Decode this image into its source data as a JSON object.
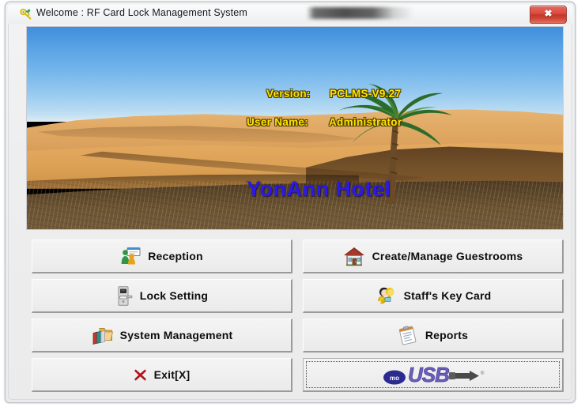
{
  "window": {
    "title": "Welcome : RF Card Lock Management System",
    "title_icon": "key-icon",
    "close_label": "✖",
    "redacted_region": true
  },
  "banner": {
    "version_label": "Version:",
    "version_value": "PCLMS-V9.27",
    "username_label": "User Name:",
    "username_value": "Administrator",
    "hotel_name": "YonAnn Hotel",
    "scene": "desert-dunes-with-palm-tree",
    "text_color_yellow": "#ffe400",
    "text_color_hotel": "#2a1ae8"
  },
  "menu": {
    "buttons": [
      {
        "id": "reception",
        "label": "Reception",
        "icon": "reception-desk-icon",
        "column": "left",
        "row": 1,
        "focused": false
      },
      {
        "id": "guestrooms",
        "label": "Create/Manage Guestrooms",
        "icon": "house-icon",
        "column": "right",
        "row": 1,
        "focused": false
      },
      {
        "id": "lock-setting",
        "label": "Lock Setting",
        "icon": "door-lock-icon",
        "column": "left",
        "row": 2,
        "focused": false
      },
      {
        "id": "staff-key-card",
        "label": "Staff's Key Card",
        "icon": "staff-key-icon",
        "column": "right",
        "row": 2,
        "focused": false
      },
      {
        "id": "system-management",
        "label": "System Management",
        "icon": "books-folder-icon",
        "column": "left",
        "row": 3,
        "focused": false
      },
      {
        "id": "reports",
        "label": "Reports",
        "icon": "clipboard-icon",
        "column": "right",
        "row": 3,
        "focused": false
      },
      {
        "id": "exit",
        "label": "Exit[X]",
        "icon": "red-x-icon",
        "column": "left",
        "row": 4,
        "focused": false
      },
      {
        "id": "usb",
        "label": "",
        "icon": "usb-logo-icon",
        "column": "right",
        "row": 4,
        "focused": true
      }
    ]
  },
  "colors": {
    "window_face": "#eeeeee",
    "button_face": "#efefef",
    "close_red": "#d94b3e",
    "sky_blue": "#59a2e4",
    "sand_orange": "#dca155"
  }
}
